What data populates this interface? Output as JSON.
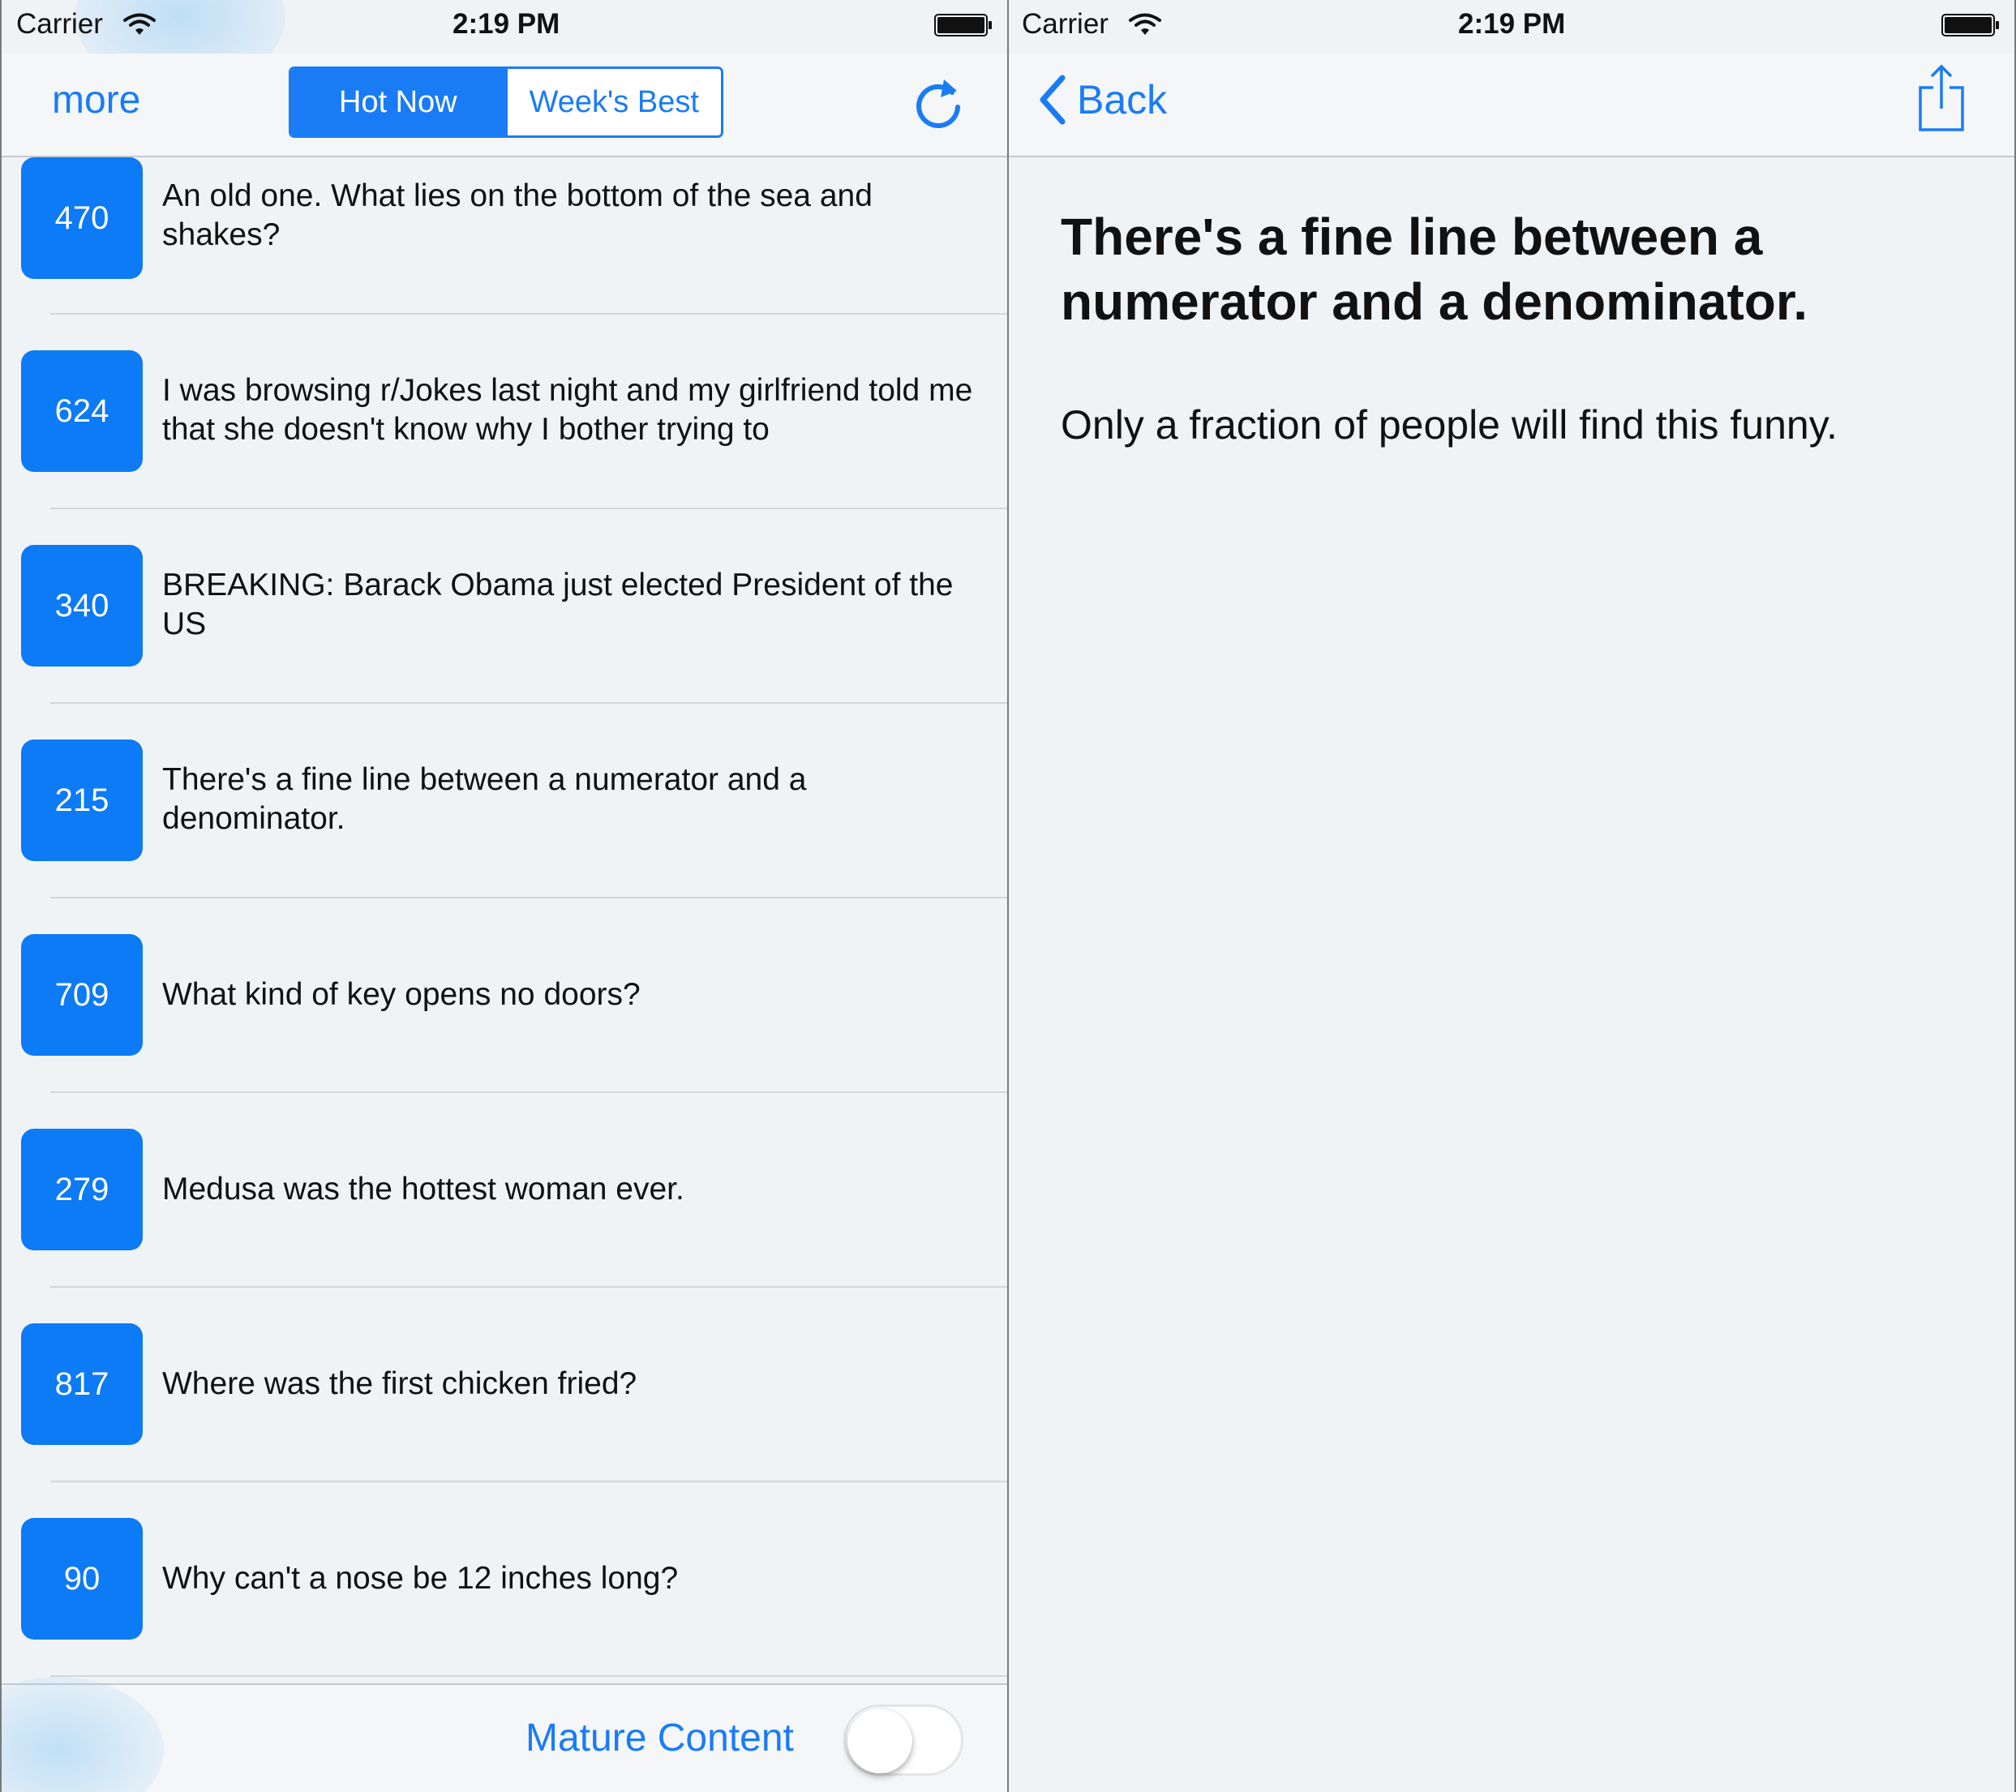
{
  "left_pane": {
    "status": {
      "carrier": "Carrier",
      "time": "2:19 PM"
    },
    "nav": {
      "more_label": "more",
      "segments": [
        "Hot Now",
        "Week's Best"
      ],
      "selected_segment": "Hot Now"
    },
    "jokes": [
      {
        "score": "470",
        "text": "An old one. What lies on the bottom of the sea and shakes?"
      },
      {
        "score": "624",
        "text": "I was browsing r/Jokes last night and my girlfriend told me that she doesn't know why I bother trying to"
      },
      {
        "score": "340",
        "text": "BREAKING: Barack Obama just elected President of the US"
      },
      {
        "score": "215",
        "text": "There's a fine line between a numerator and a denominator."
      },
      {
        "score": "709",
        "text": "What kind of key opens no doors?"
      },
      {
        "score": "279",
        "text": "Medusa was the hottest woman ever."
      },
      {
        "score": "817",
        "text": "Where was the first chicken fried?"
      },
      {
        "score": "90",
        "text": "Why can't a nose be 12 inches long?"
      }
    ],
    "toolbar": {
      "mature_label": "Mature Content",
      "mature_enabled": false
    }
  },
  "right_pane": {
    "status": {
      "carrier": "Carrier",
      "time": "2:19 PM"
    },
    "nav": {
      "back_label": "Back"
    },
    "detail": {
      "title": "There's a fine line between a numerator and a denominator.",
      "body": "Only a fraction of people will find this funny."
    }
  },
  "colors": {
    "accent": "#1a7cf5",
    "badge": "#0d7af6",
    "background": "#f0f3f6"
  },
  "icons": [
    "wifi-icon",
    "battery-icon",
    "refresh-icon",
    "chevron-left-icon",
    "share-icon"
  ]
}
